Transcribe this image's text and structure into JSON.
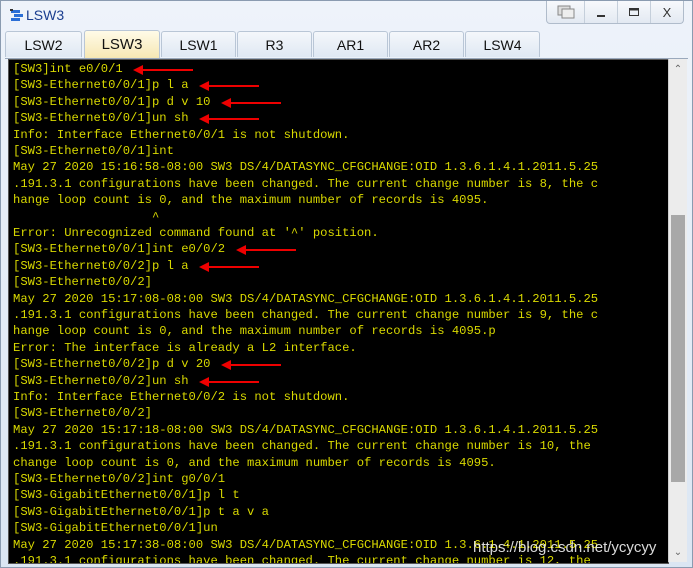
{
  "window": {
    "title": "LSW3",
    "icon": "switch-icon",
    "controls": [
      {
        "name": "restore-layout-button",
        "icon": "window-tile-icon",
        "label": "▭"
      },
      {
        "name": "minimize-button",
        "icon": "minimize-icon",
        "label": "_"
      },
      {
        "name": "maximize-button",
        "icon": "maximize-icon",
        "label": "☐"
      },
      {
        "name": "close-button",
        "icon": "close-icon",
        "label": "X"
      }
    ]
  },
  "tabs": [
    {
      "label": "LSW2",
      "active": false
    },
    {
      "label": "LSW3",
      "active": true
    },
    {
      "label": "LSW1",
      "active": false
    },
    {
      "label": "R3",
      "active": false
    },
    {
      "label": "AR1",
      "active": false
    },
    {
      "label": "AR2",
      "active": false
    },
    {
      "label": "LSW4",
      "active": false
    }
  ],
  "terminal": {
    "text_color": "#d9d900",
    "background": "#000000",
    "lines": [
      "[SW3]int e0/0/1",
      "[SW3-Ethernet0/0/1]p l a",
      "[SW3-Ethernet0/0/1]p d v 10",
      "[SW3-Ethernet0/0/1]un sh",
      "Info: Interface Ethernet0/0/1 is not shutdown.",
      "[SW3-Ethernet0/0/1]int",
      "May 27 2020 15:16:58-08:00 SW3 DS/4/DATASYNC_CFGCHANGE:OID 1.3.6.1.4.1.2011.5.25",
      ".191.3.1 configurations have been changed. The current change number is 8, the c",
      "hange loop count is 0, and the maximum number of records is 4095.",
      "                   ^",
      "Error: Unrecognized command found at '^' position.",
      "[SW3-Ethernet0/0/1]int e0/0/2",
      "[SW3-Ethernet0/0/2]p l a",
      "[SW3-Ethernet0/0/2]",
      "May 27 2020 15:17:08-08:00 SW3 DS/4/DATASYNC_CFGCHANGE:OID 1.3.6.1.4.1.2011.5.25",
      ".191.3.1 configurations have been changed. The current change number is 9, the c",
      "hange loop count is 0, and the maximum number of records is 4095.p",
      "Error: The interface is already a L2 interface.",
      "[SW3-Ethernet0/0/2]p d v 20",
      "[SW3-Ethernet0/0/2]un sh",
      "Info: Interface Ethernet0/0/2 is not shutdown.",
      "[SW3-Ethernet0/0/2]",
      "May 27 2020 15:17:18-08:00 SW3 DS/4/DATASYNC_CFGCHANGE:OID 1.3.6.1.4.1.2011.5.25",
      ".191.3.1 configurations have been changed. The current change number is 10, the",
      "change loop count is 0, and the maximum number of records is 4095.",
      "[SW3-Ethernet0/0/2]int g0/0/1",
      "[SW3-GigabitEthernet0/0/1]p l t",
      "[SW3-GigabitEthernet0/0/1]p t a v a",
      "[SW3-GigabitEthernet0/0/1]un",
      "May 27 2020 15:17:38-08:00 SW3 DS/4/DATASYNC_CFGCHANGE:OID 1.3.6.1.4.1.2011.5.25",
      ".191.3.1 configurations have been changed. The current change number is 12, the"
    ],
    "annotated_lines": [
      0,
      1,
      2,
      3,
      11,
      12,
      18,
      19
    ],
    "annotation_color": "#ee0000"
  },
  "scrollbar": {
    "up_icon": "chevron-up-icon",
    "down_icon": "chevron-down-icon",
    "thumb_start_fraction": 0.31,
    "thumb_end_fraction": 0.84
  },
  "watermark": "https://blog.csdn.net/ycycyy"
}
